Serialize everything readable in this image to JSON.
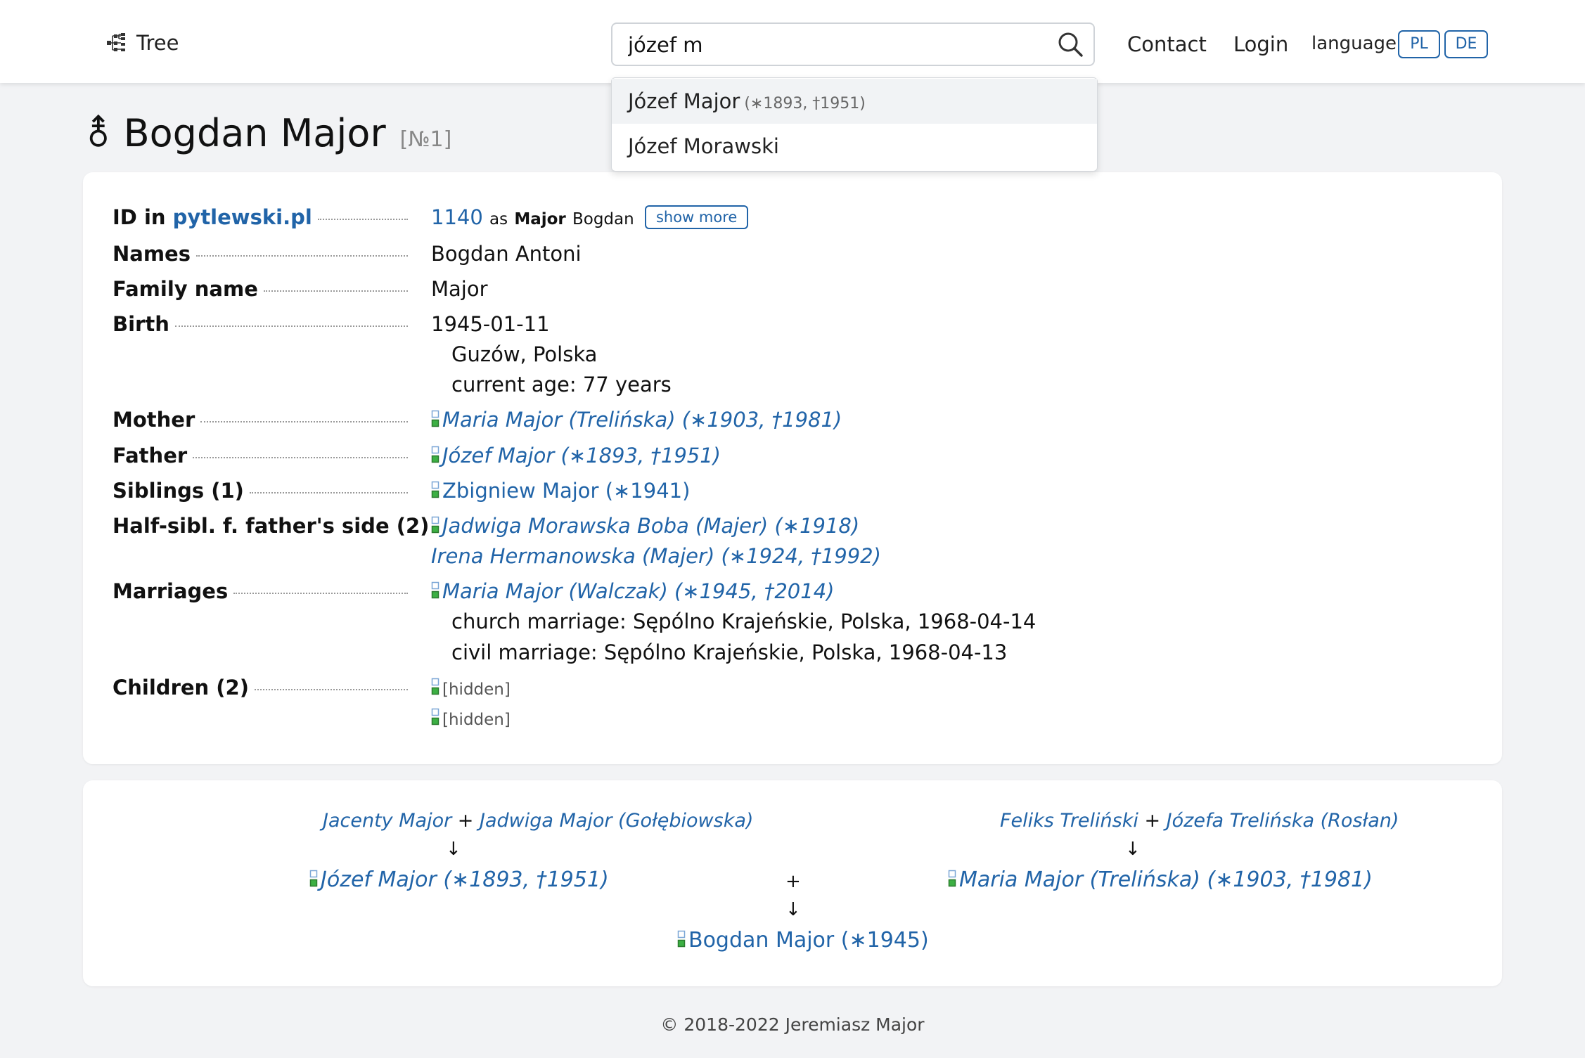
{
  "header": {
    "brand_label": "Tree",
    "search_value": "józef m",
    "nav": {
      "contact": "Contact",
      "login": "Login"
    },
    "language_label": "language:",
    "languages": [
      "PL",
      "DE"
    ]
  },
  "search_suggestions": [
    {
      "name": "Józef Major",
      "meta": "(∗1893, †1951)"
    },
    {
      "name": "Józef Morawski",
      "meta": ""
    }
  ],
  "person": {
    "gender_symbol": "⚨",
    "given_name": "Bogdan",
    "family_name": "Major",
    "number": "[№1]"
  },
  "details": {
    "id_label": "ID in",
    "id_site": "pytlewski.pl",
    "id_value": "1140",
    "id_as": "as",
    "id_as_surname": "Major",
    "id_as_given": "Bogdan",
    "show_more": "show more",
    "names_label": "Names",
    "names_value": "Bogdan Antoni",
    "family_name_label": "Family name",
    "family_name_value": "Major",
    "birth_label": "Birth",
    "birth_date": "1945-01-11",
    "birth_place": "Guzów, Polska",
    "birth_age": "current age: 77 years",
    "mother_label": "Mother",
    "mother_value": "Maria Major (Trelińska) (∗1903, †1981)",
    "father_label": "Father",
    "father_value": "Józef Major (∗1893, †1951)",
    "siblings_label": "Siblings (1)",
    "siblings": [
      "Zbigniew Major (∗1941)"
    ],
    "half_siblings_label": "Half-sibl. f. father's side (2)",
    "half_siblings": [
      "Jadwiga Morawska Boba (Majer) (∗1918)",
      "Irena Hermanowska (Majer) (∗1924, †1992)"
    ],
    "marriages_label": "Marriages",
    "spouse": "Maria Major (Walczak) (∗1945, †2014)",
    "church_marriage": "church marriage: Sępólno Krajeńskie, Polska, 1968-04-14",
    "civil_marriage": "civil marriage: Sępólno Krajeńskie, Polska, 1968-04-13",
    "children_label": "Children (2)",
    "children": [
      "[hidden]",
      "[hidden]"
    ]
  },
  "family_tree": {
    "paternal_grandfather": "Jacenty Major",
    "paternal_grandmother": "Jadwiga Major (Gołębiowska)",
    "maternal_grandfather": "Feliks Treliński",
    "maternal_grandmother": "Józefa Trelińska (Rosłan)",
    "plus": "+",
    "arrow": "↓",
    "father": "Józef Major (∗1893, †1951)",
    "mother": "Maria Major (Trelińska) (∗1903, †1981)",
    "self": "Bogdan Major (∗1945)"
  },
  "footer": "© 2018-2022 Jeremiasz Major",
  "colors": {
    "link": "#2164a8",
    "background": "#f2f3f5",
    "icon_green": "#3cb043"
  }
}
